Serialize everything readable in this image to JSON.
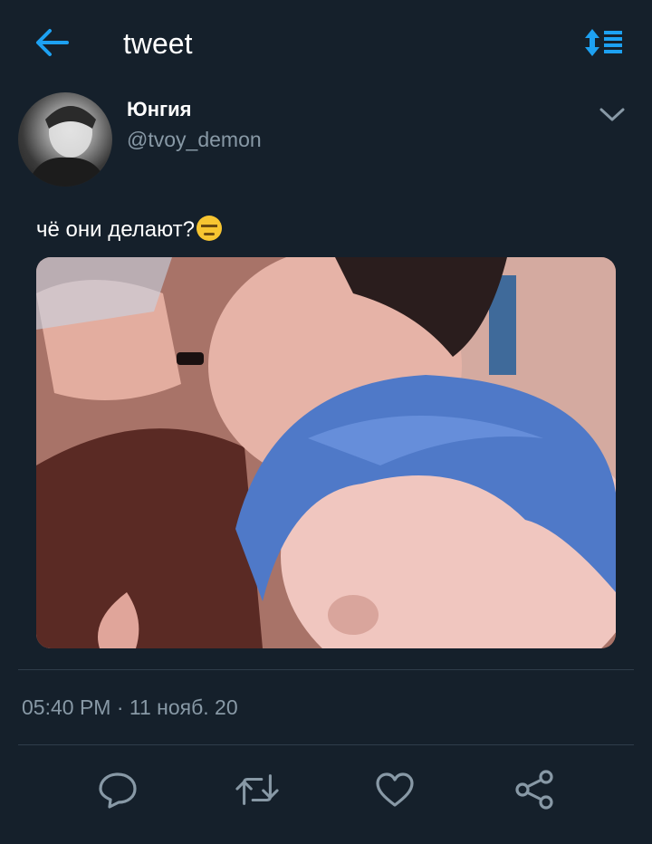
{
  "header": {
    "title": "tweet",
    "back_icon": "arrow-left-icon",
    "sort_icon": "sort-timeline-icon"
  },
  "tweet": {
    "author": {
      "display_name": "Юнгия",
      "handle": "@tvoy_demon"
    },
    "text": "чё они делают?",
    "emoji": "expressionless-face",
    "timestamp": "05:40 PM · 11 нояб. 20"
  },
  "actions": [
    {
      "name": "reply",
      "icon": "comment-icon"
    },
    {
      "name": "retweet",
      "icon": "retweet-icon"
    },
    {
      "name": "like",
      "icon": "heart-icon"
    },
    {
      "name": "share",
      "icon": "share-icon"
    }
  ],
  "colors": {
    "background": "#15202b",
    "accent": "#1da1f2",
    "secondary_text": "#8899a6",
    "divider": "#2f3d4a"
  }
}
